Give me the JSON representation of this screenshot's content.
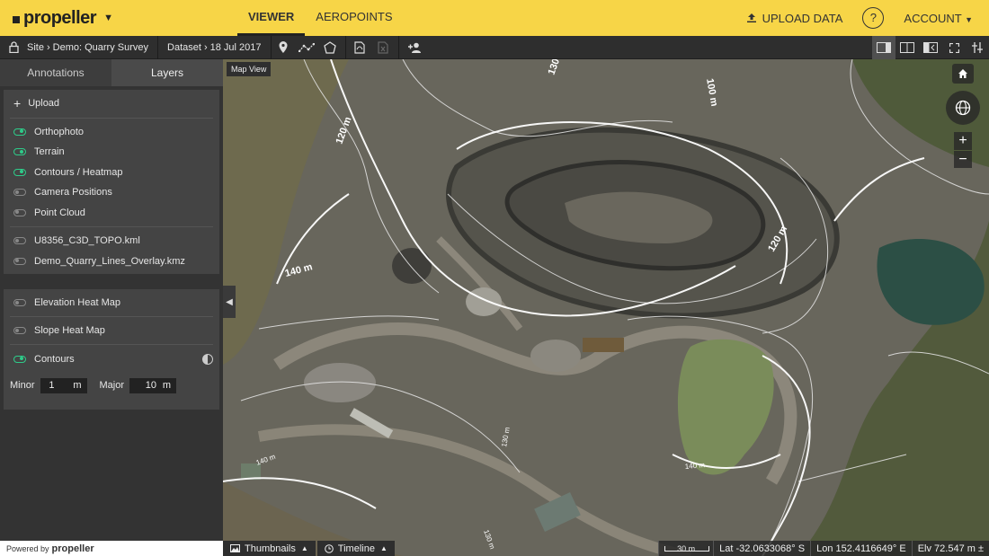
{
  "header": {
    "logo": "propeller",
    "tabs": [
      {
        "label": "VIEWER",
        "active": true
      },
      {
        "label": "AEROPOINTS",
        "active": false
      }
    ],
    "upload_label": "UPLOAD DATA",
    "help_label": "?",
    "account_label": "ACCOUNT"
  },
  "toolbar": {
    "site": "Site",
    "site_name": "Demo: Quarry Survey",
    "dataset": "Dataset",
    "dataset_date": "18 Jul 2017"
  },
  "sidebar": {
    "tabs": [
      {
        "label": "Annotations",
        "active": false
      },
      {
        "label": "Layers",
        "active": true
      }
    ],
    "upload_label": "Upload",
    "layers": [
      {
        "label": "Orthophoto",
        "on": true
      },
      {
        "label": "Terrain",
        "on": true
      },
      {
        "label": "Contours / Heatmap",
        "on": true
      },
      {
        "label": "Camera Positions",
        "on": false
      },
      {
        "label": "Point Cloud",
        "on": false
      }
    ],
    "files": [
      {
        "label": "U8356_C3D_TOPO.kml",
        "on": false
      },
      {
        "label": "Demo_Quarry_Lines_Overlay.kmz",
        "on": false
      }
    ],
    "heatmaps": [
      {
        "label": "Elevation Heat Map",
        "on": false
      },
      {
        "label": "Slope Heat Map",
        "on": false
      },
      {
        "label": "Contours",
        "on": true
      }
    ],
    "minor_label": "Minor",
    "minor_value": "1",
    "minor_unit": "m",
    "major_label": "Major",
    "major_value": "10",
    "major_unit": "m",
    "powered_by": "Powered by",
    "powered_brand": "propeller"
  },
  "map": {
    "view_label": "Map View",
    "contour_labels": [
      "130",
      "100 m",
      "120 m",
      "120 m",
      "140 m",
      "130 m",
      "140 m",
      "140 m",
      "130 m"
    ],
    "scale_label": "30 m",
    "lat": "Lat -32.0633068° S",
    "lon": "Lon 152.4116649° E",
    "elv": "Elv 72.547 m ±"
  },
  "bottom": {
    "thumbnails_label": "Thumbnails",
    "timeline_label": "Timeline"
  }
}
